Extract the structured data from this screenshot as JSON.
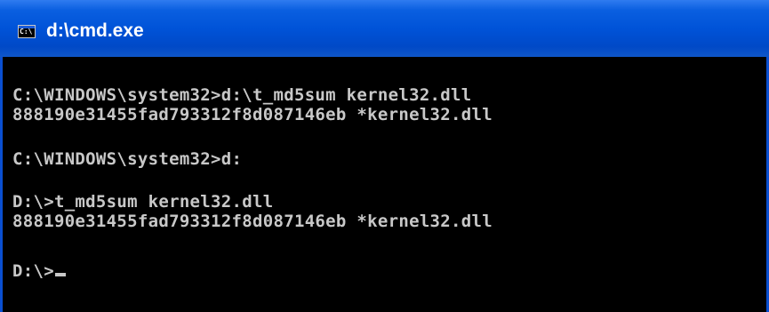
{
  "window": {
    "title": "d:\\cmd.exe",
    "icon": "cmd-window-icon",
    "icon_text": "C:\\"
  },
  "console": {
    "lines": [
      "C:\\WINDOWS\\system32>d:\\t_md5sum kernel32.dll",
      "888190e31455fad793312f8d087146eb *kernel32.dll",
      "",
      "C:\\WINDOWS\\system32>d:",
      "",
      "D:\\>t_md5sum kernel32.dll",
      "888190e31455fad793312f8d087146eb *kernel32.dll",
      "",
      "D:\\>"
    ]
  },
  "colors": {
    "titlebar": "#0053d8",
    "console_bg": "#000000",
    "console_text": "#c8c8c8"
  }
}
